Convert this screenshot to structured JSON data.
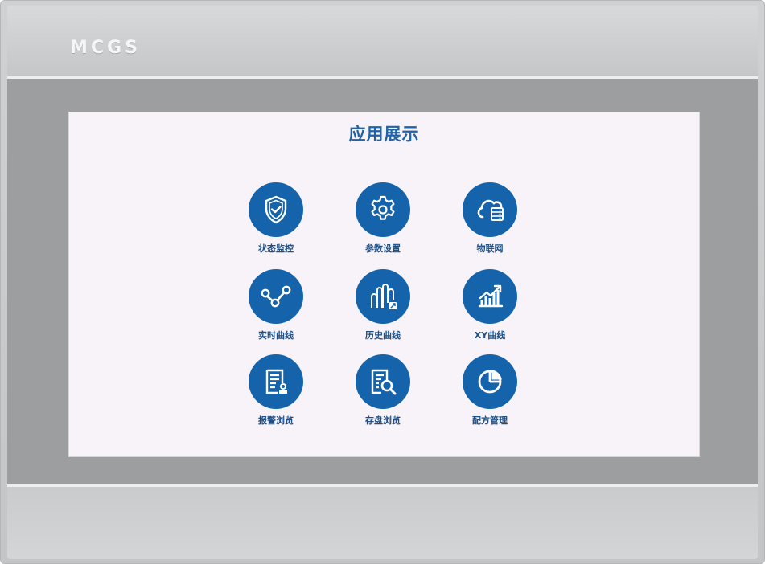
{
  "device": {
    "brand": "MCGS"
  },
  "screen": {
    "title": "应用展示",
    "apps": [
      {
        "label": "状态监控",
        "icon": "shield-check-icon"
      },
      {
        "label": "参数设置",
        "icon": "gear-icon"
      },
      {
        "label": "物联网",
        "icon": "cloud-server-icon"
      },
      {
        "label": "实时曲线",
        "icon": "line-graph-nodes-icon"
      },
      {
        "label": "历史曲线",
        "icon": "bar-history-icon"
      },
      {
        "label": "XY曲线",
        "icon": "trend-chart-icon"
      },
      {
        "label": "报警浏览",
        "icon": "alarm-document-icon"
      },
      {
        "label": "存盘浏览",
        "icon": "document-search-icon"
      },
      {
        "label": "配方管理",
        "icon": "pie-chart-icon"
      }
    ]
  },
  "colors": {
    "accent": "#1564ab",
    "title": "#1f63a8",
    "screen_background": "#f7f3f8",
    "bezel": "#9d9e9f"
  }
}
